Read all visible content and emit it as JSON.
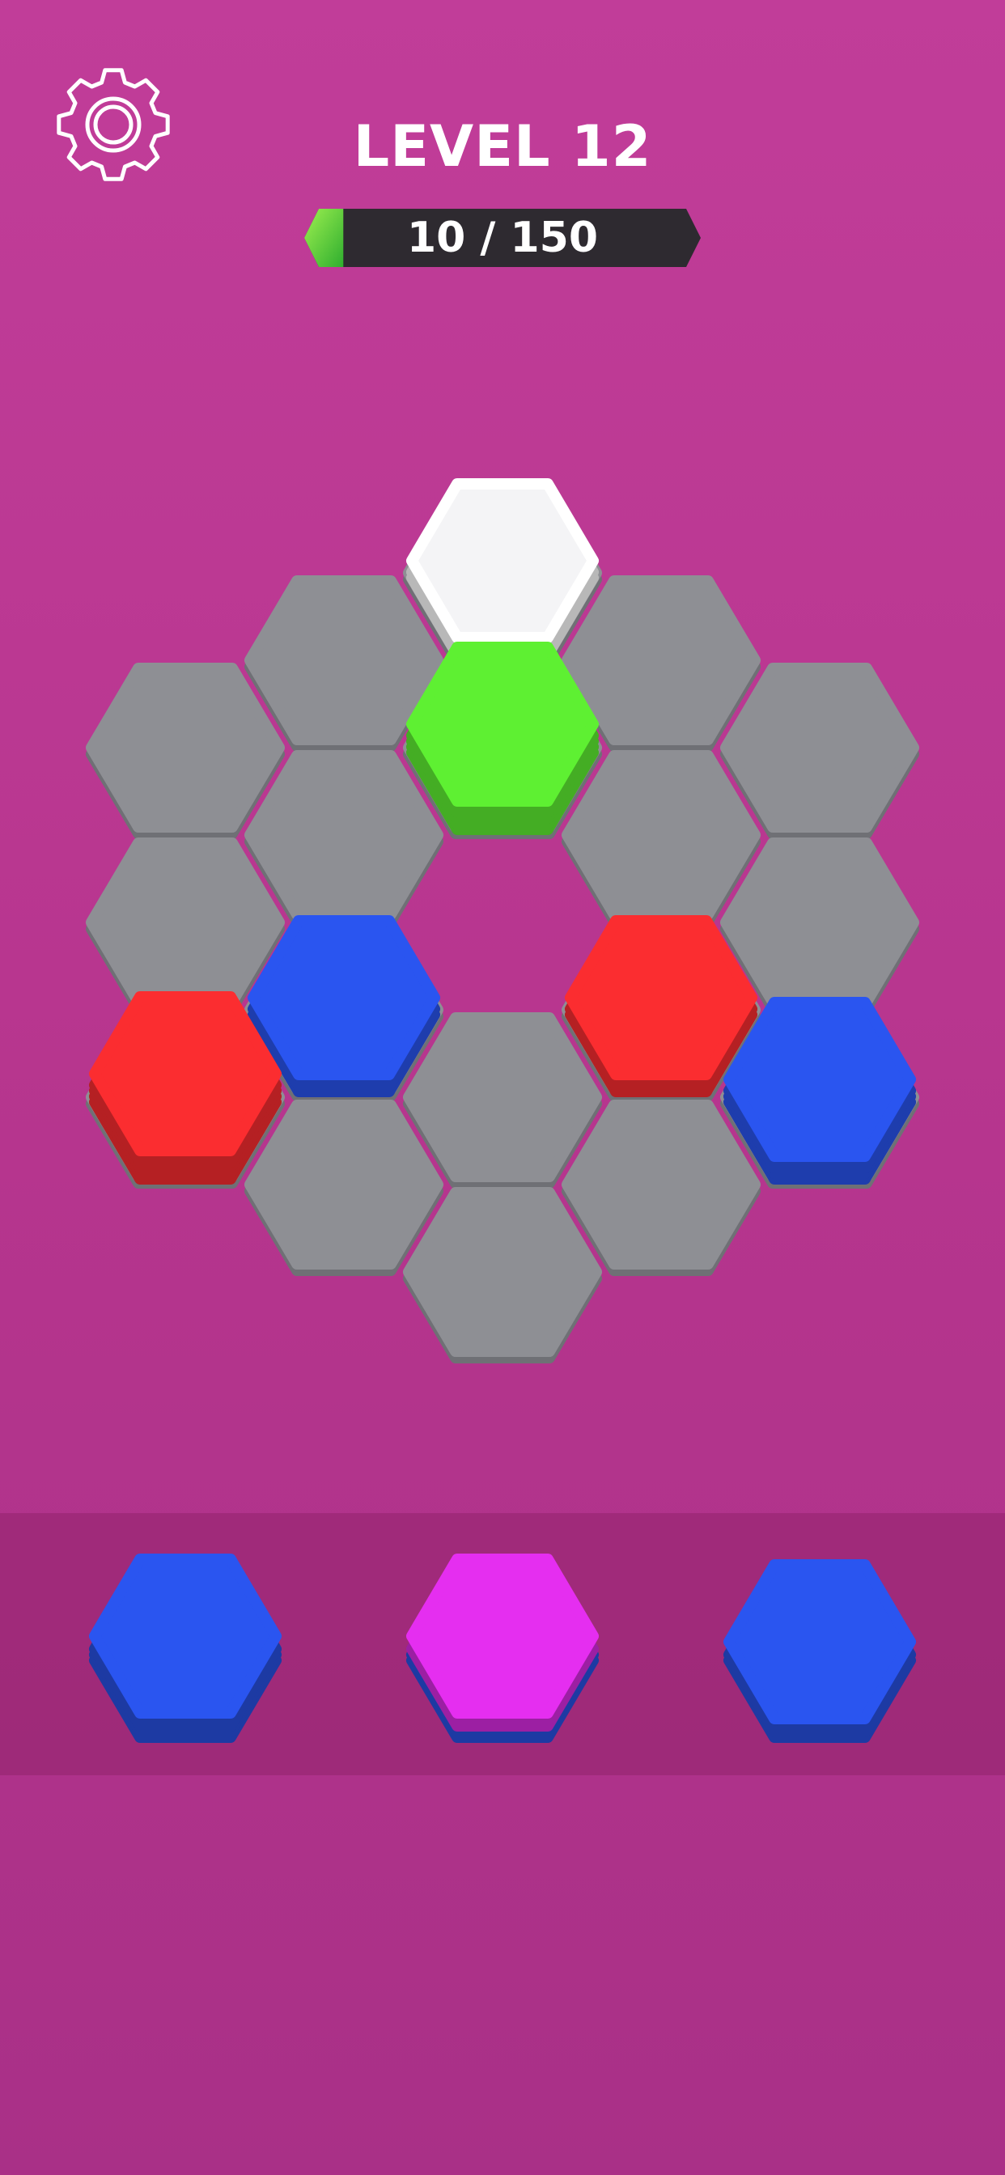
{
  "header": {
    "level_title": "LEVEL 12",
    "progress_text": "10 / 150",
    "progress_fraction": 0.0667,
    "settings_icon": "gear-icon"
  },
  "colors": {
    "empty": "#8e8f94",
    "white": "#ffffff",
    "green": "#5ef032",
    "blue": "#2a55f0",
    "red": "#fb2d30",
    "magenta": "#e52ef0"
  },
  "board": {
    "cells": [
      {
        "id": "top",
        "state": "white",
        "layers": 2
      },
      {
        "id": "upper-left",
        "state": "empty"
      },
      {
        "id": "upper-right",
        "state": "empty"
      },
      {
        "id": "center-top",
        "state": "green",
        "layers": 4
      },
      {
        "id": "far-left-top",
        "state": "empty"
      },
      {
        "id": "far-right-top",
        "state": "empty"
      },
      {
        "id": "inner-left-top",
        "state": "empty"
      },
      {
        "id": "inner-right-top",
        "state": "empty"
      },
      {
        "id": "far-left-mid",
        "state": "empty"
      },
      {
        "id": "far-right-mid",
        "state": "empty"
      },
      {
        "id": "inner-left-mid",
        "state": "blue",
        "layers": 2
      },
      {
        "id": "inner-right-mid",
        "state": "red",
        "layers": 2
      },
      {
        "id": "center-low",
        "state": "empty"
      },
      {
        "id": "far-left-low",
        "state": "red",
        "layers": 4
      },
      {
        "id": "far-right-low",
        "state": "blue",
        "layers": 3
      },
      {
        "id": "inner-left-low",
        "state": "empty"
      },
      {
        "id": "inner-right-low",
        "state": "empty"
      },
      {
        "id": "bottom",
        "state": "empty"
      }
    ]
  },
  "tray": {
    "stacks": [
      {
        "id": "left",
        "color": "blue",
        "layers": 3
      },
      {
        "id": "center",
        "color": "magenta",
        "layers": 3
      },
      {
        "id": "right",
        "color": "blue",
        "layers": 2
      }
    ]
  }
}
